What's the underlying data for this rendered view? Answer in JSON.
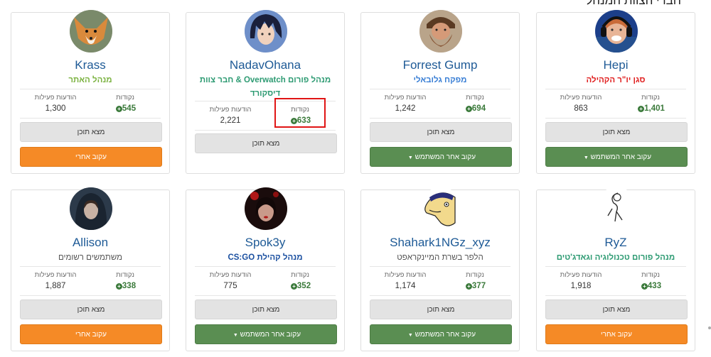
{
  "page": {
    "heading": "חברי הצוות המנהל"
  },
  "labels": {
    "points": "נקודות",
    "posts": "הודעות פעילות",
    "find_content": "מצא תוכן",
    "follow": "עקוב אחרי",
    "follow_user": "עקוב אחר המשתמש"
  },
  "colors": {
    "username": "#1e5a96",
    "points": "#3b7a3b",
    "follow_orange": "#f58a26",
    "follow_green": "#5a8e52",
    "highlight_box": "#e01515"
  },
  "members": [
    {
      "name": "Krass",
      "role": "מנהל האתר",
      "role_color": "#7cb342",
      "points": "545",
      "posts": "1,300",
      "follow_style": "orange",
      "avatar": "fox-avatar"
    },
    {
      "name": "NadavOhana",
      "role": "מנהל פורום Overwatch & חבר צוות דיסקורד",
      "role_color": "#2e9b73",
      "points": "633",
      "posts": "2,221",
      "follow_style": "none",
      "avatar": "anime-avatar"
    },
    {
      "name": "Forrest Gump",
      "role": "מפקח גלובאלי",
      "role_color": "#3a7fd5",
      "points": "694",
      "posts": "1,242",
      "follow_style": "green",
      "avatar": "bearded-man-avatar"
    },
    {
      "name": "Hepi",
      "role": "סגן יו\"ר הקהילה",
      "role_color": "#e02020",
      "points": "1,401",
      "posts": "863",
      "follow_style": "green",
      "avatar": "headset-man-avatar"
    },
    {
      "name": "Allison",
      "role": "משתמשים רשומים",
      "role_color": "#555555",
      "points": "338",
      "posts": "1,887",
      "follow_style": "orange",
      "avatar": "hooded-girl-avatar"
    },
    {
      "name": "Spok3y",
      "role": "מנהל קהילת CS:GO",
      "role_color": "#1a4fa0",
      "points": "352",
      "posts": "775",
      "follow_style": "green",
      "avatar": "red-portrait-avatar"
    },
    {
      "name": "Shahark1NGz_xyz",
      "role": "הלפר בשרת המיינקראפט",
      "role_color": "#555555",
      "points": "377",
      "posts": "1,174",
      "follow_style": "green",
      "avatar": "cartoon-face-avatar"
    },
    {
      "name": "RyZ",
      "role": "מנהל פורום טכנולוגיה וגאדג'טים",
      "role_color": "#2e9b73",
      "points": "433",
      "posts": "1,918",
      "follow_style": "orange",
      "avatar": "sketch-avatar"
    }
  ]
}
